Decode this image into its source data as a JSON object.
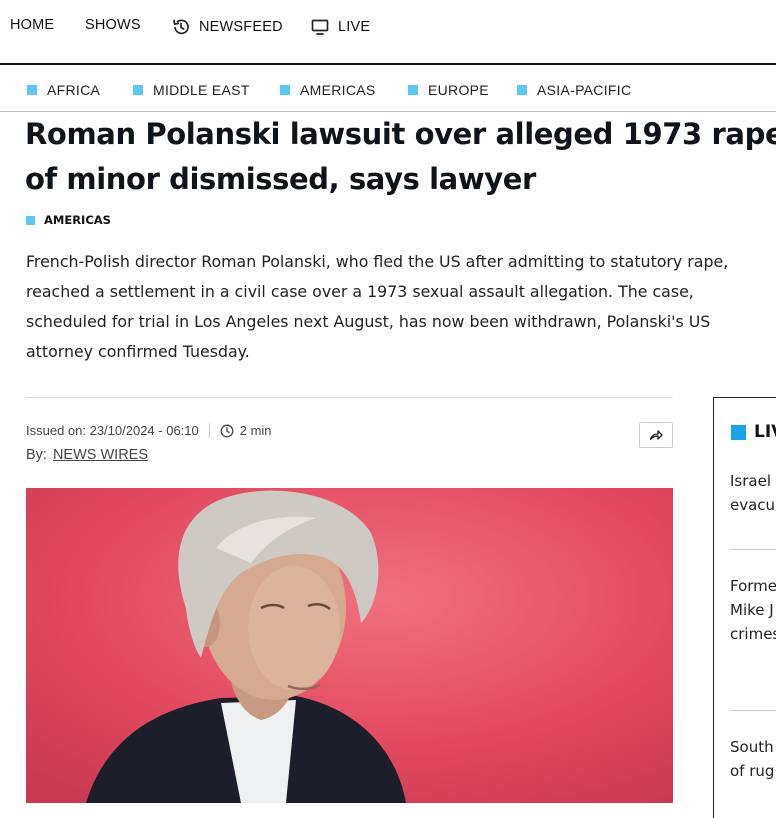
{
  "nav": {
    "home": "HOME",
    "shows": "SHOWS",
    "newsfeed": "NEWSFEED",
    "live": "LIVE"
  },
  "regions": [
    "AFRICA",
    "MIDDLE EAST",
    "AMERICAS",
    "EUROPE",
    "ASIA-PACIFIC"
  ],
  "article": {
    "title": "Roman Polanski lawsuit over alleged 1973 rape of minor dismissed, says lawyer",
    "category": "AMERICAS",
    "lead": "French-Polish director Roman Polanski, who fled the US after admitting to statutory rape, reached a settlement in a civil case over a 1973 sexual assault allegation. The case, scheduled for trial in Los Angeles next August, has now been withdrawn, Polanski's US attorney confirmed Tuesday.",
    "issued": "Issued on: 23/10/2024 - 06:10",
    "read_time": "2 min",
    "by_label": "By:",
    "author": "NEWS WIRES"
  },
  "live_sidebar": {
    "heading": "LIV",
    "stories": [
      [
        "Israel",
        "evacu"
      ],
      [
        "Forme",
        "Mike J",
        "crimes"
      ],
      [
        "South",
        "of rug"
      ]
    ]
  },
  "colors": {
    "accent_square": "#5ac8f5",
    "live_square": "#1aa3e8",
    "photo_background": "#e0445e"
  }
}
